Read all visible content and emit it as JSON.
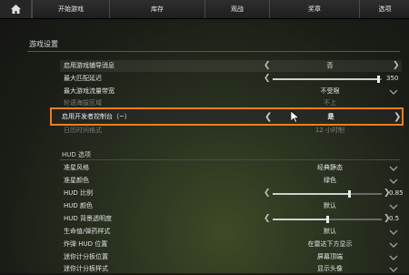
{
  "nav": {
    "home_icon": "home-icon",
    "items": [
      {
        "label": "开始游戏"
      },
      {
        "label": "库存"
      },
      {
        "label": "观战"
      },
      {
        "label": "奖章"
      },
      {
        "label": "选项"
      }
    ]
  },
  "game_settings": {
    "title": "游戏设置",
    "rows": [
      {
        "label": "启用游戏辅导消息",
        "value": "否"
      },
      {
        "label": "最大匹配延迟",
        "value": "350",
        "slider_fraction": 0.97
      },
      {
        "label": "最大游戏流量带宽",
        "value": "不受限"
      },
      {
        "label": "轮语海拔区域",
        "value": "不上"
      },
      {
        "label": "启用开发者控制台（~）",
        "value": "是"
      },
      {
        "label": "日历时间格式",
        "value": "12 小时制"
      }
    ]
  },
  "hud": {
    "title": "HUD 选项",
    "rows": [
      {
        "label": "准星风格",
        "value": "经典静态"
      },
      {
        "label": "准星颜色",
        "value": "绿色"
      },
      {
        "label": "HUD 比例",
        "value": "0.85",
        "slider_fraction": 0.7
      },
      {
        "label": "HUD 颜色",
        "value": "默认"
      },
      {
        "label": "HUD 背景透明度",
        "value": "0.5",
        "slider_fraction": 0.5
      },
      {
        "label": "生命值/弹药样式",
        "value": "默认"
      },
      {
        "label": "炸弹 HUD 位置",
        "value": "在雷达下方显示"
      },
      {
        "label": "迷你计分板位置",
        "value": "屏幕顶端"
      },
      {
        "label": "迷你计分板样式",
        "value": "显示头像"
      }
    ]
  },
  "colors": {
    "focus_outline": "#ef7d1e"
  }
}
